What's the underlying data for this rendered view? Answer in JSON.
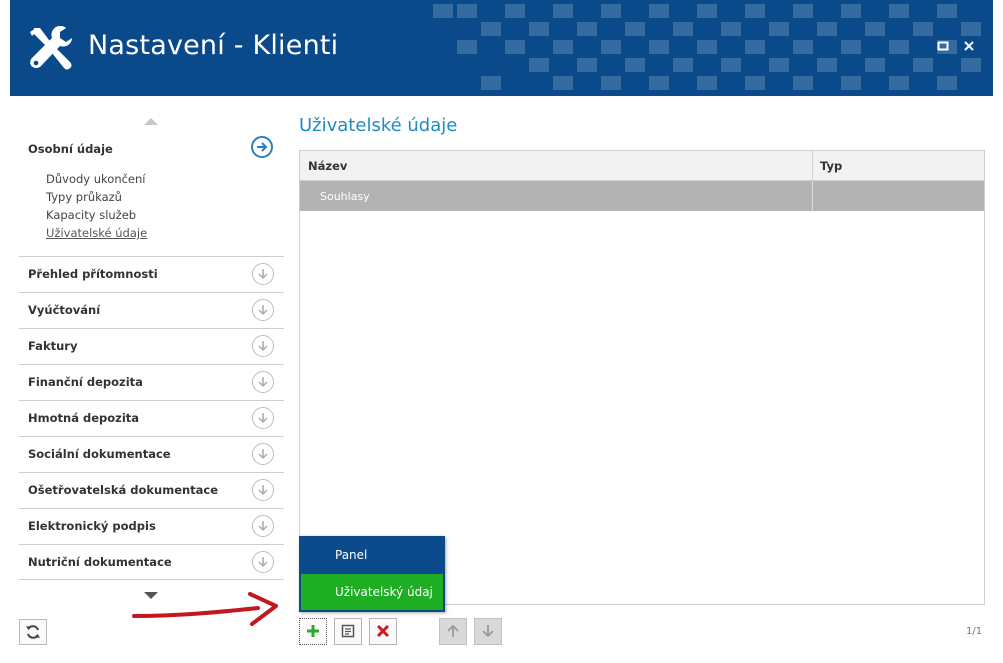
{
  "window": {
    "title": "Nastavení - Klienti",
    "logo_icon": "tools-icon",
    "maximize_icon": "maximize-icon",
    "close_icon": "close-icon",
    "header_color": "#0a4a8a"
  },
  "sidebar": {
    "open_section": {
      "label": "Osobní údaje",
      "items": [
        "Důvody ukončení",
        "Typy průkazů",
        "Kapacity služeb",
        "Uživatelské údaje"
      ],
      "active_item": "Uživatelské údaje"
    },
    "sections": [
      "Přehled přítomnosti",
      "Vyúčtování",
      "Faktury",
      "Finanční depozita",
      "Hmotná depozita",
      "Sociální dokumentace",
      "Ošetřovatelská dokumentace",
      "Elektronický podpis",
      "Nutriční dokumentace"
    ]
  },
  "main": {
    "title": "Uživatelské údaje",
    "columns": [
      "Název",
      "Typ"
    ],
    "rows": [
      {
        "name": "Souhlasy",
        "type": ""
      }
    ],
    "pager": "1/1"
  },
  "add_menu": {
    "items": [
      "Panel",
      "Uživatelský údaj"
    ],
    "highlighted": "Uživatelský údaj",
    "highlight_color": "#1eae23"
  },
  "accent_color": "#1e8bc3"
}
